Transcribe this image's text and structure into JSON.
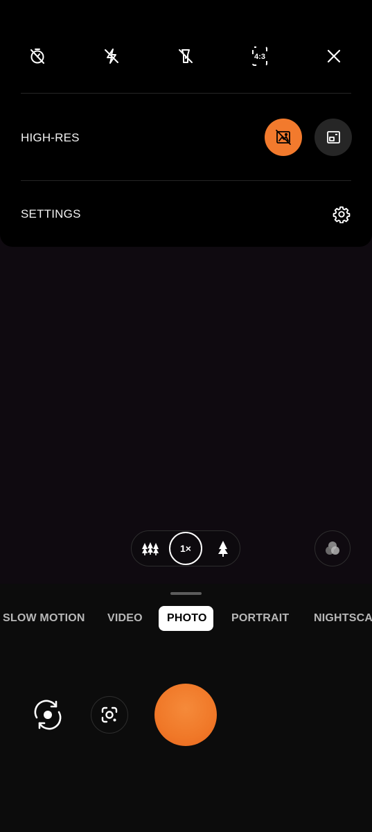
{
  "quick_settings": {
    "icons": [
      "timer-off-icon",
      "flash-off-icon",
      "torch-off-icon",
      "aspect-ratio-icon",
      "close-icon"
    ],
    "aspect_ratio_label": "4:3",
    "high_res": {
      "label": "HIGH-RES",
      "options": [
        "high-res-off-icon",
        "high-res-on-icon"
      ],
      "selected": "high-res-off-icon"
    },
    "settings": {
      "label": "SETTINGS",
      "icon": "gear-icon"
    }
  },
  "zoom": {
    "options": [
      "wide-angle-icon",
      "1×",
      "telephoto-icon"
    ],
    "active_label": "1×"
  },
  "filter_icon": "filter-icon",
  "modes": {
    "items": [
      "SLOW MOTION",
      "VIDEO",
      "PHOTO",
      "PORTRAIT",
      "NIGHTSCA"
    ],
    "active": "PHOTO"
  },
  "controls": {
    "flip_icon": "flip-camera-icon",
    "lens_icon": "google-lens-icon",
    "shutter": "shutter-button"
  },
  "colors": {
    "accent": "#f27a2d",
    "panel": "#000000",
    "background": "#0c0c0c"
  }
}
